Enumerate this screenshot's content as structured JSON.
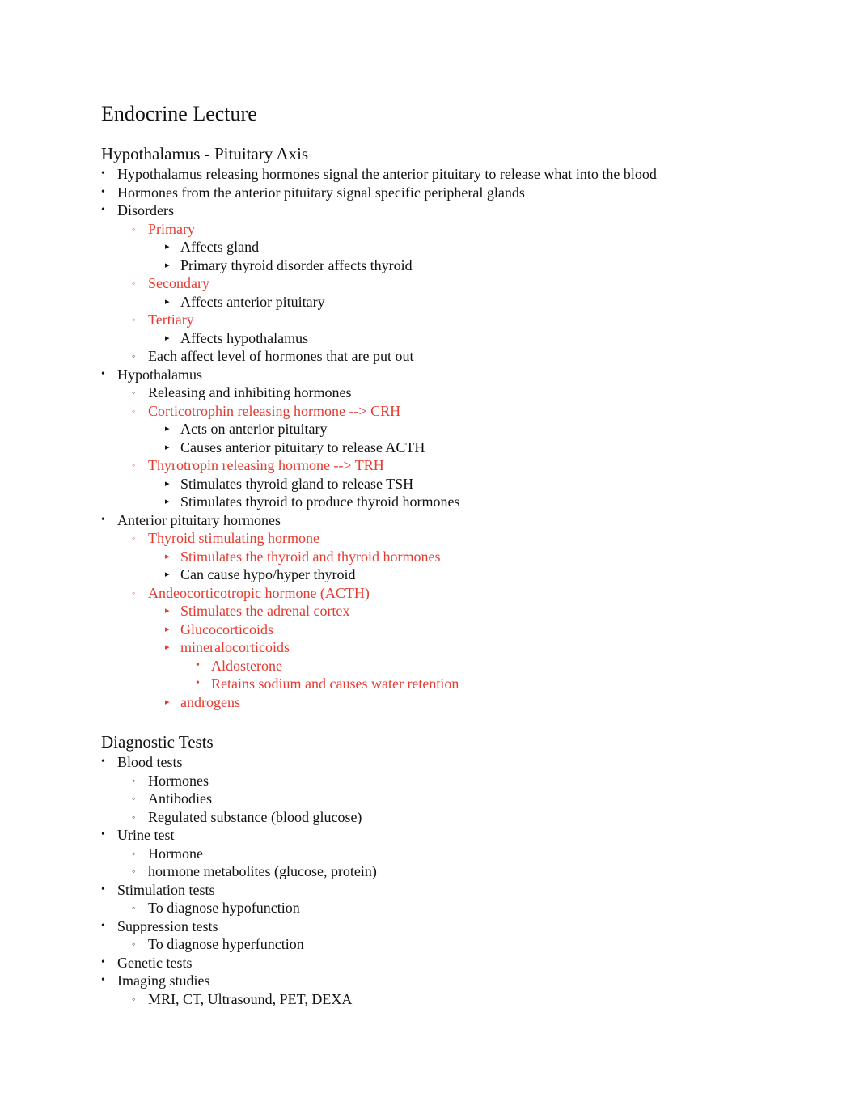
{
  "document": {
    "title": "Endocrine Lecture",
    "colors": {
      "text": "#111111",
      "highlight": "#e8392f"
    },
    "bullet_glyphs": {
      "level1": "•",
      "level2": "◦",
      "level3": "▸",
      "level4": "•"
    },
    "sections": [
      {
        "heading": "Hypothalamus - Pituitary Axis",
        "items": [
          {
            "level": 1,
            "text": "Hypothalamus releasing hormones signal the anterior pituitary to release what into the blood",
            "red": false
          },
          {
            "level": 1,
            "text": "Hormones from the anterior pituitary signal specific peripheral glands",
            "red": false
          },
          {
            "level": 1,
            "text": "Disorders",
            "red": false
          },
          {
            "level": 2,
            "text": "Primary",
            "red": true
          },
          {
            "level": 3,
            "text": "Affects gland",
            "red": false
          },
          {
            "level": 3,
            "text": "Primary thyroid disorder affects thyroid",
            "red": false
          },
          {
            "level": 2,
            "text": "Secondary",
            "red": true
          },
          {
            "level": 3,
            "text": "Affects anterior pituitary",
            "red": false
          },
          {
            "level": 2,
            "text": "Tertiary",
            "red": true
          },
          {
            "level": 3,
            "text": "Affects hypothalamus",
            "red": false
          },
          {
            "level": 2,
            "text": "Each affect level of hormones that are put out",
            "red": false
          },
          {
            "level": 1,
            "text": "Hypothalamus",
            "red": false
          },
          {
            "level": 2,
            "text": "Releasing and inhibiting hormones",
            "red": false
          },
          {
            "level": 2,
            "text": "Corticotrophin releasing hormone --> CRH",
            "red": true
          },
          {
            "level": 3,
            "text": "Acts on anterior pituitary",
            "red": false
          },
          {
            "level": 3,
            "text": "Causes anterior pituitary to release ACTH",
            "red": false
          },
          {
            "level": 2,
            "text": "Thyrotropin releasing hormone --> TRH",
            "red": true
          },
          {
            "level": 3,
            "text": "Stimulates thyroid gland to release TSH",
            "red": false
          },
          {
            "level": 3,
            "text": "Stimulates thyroid to produce thyroid hormones",
            "red": false
          },
          {
            "level": 1,
            "text": "Anterior pituitary hormones",
            "red": false
          },
          {
            "level": 2,
            "text": "Thyroid stimulating hormone",
            "red": true
          },
          {
            "level": 3,
            "text": "Stimulates the thyroid and thyroid hormones",
            "red": true
          },
          {
            "level": 3,
            "text": "Can cause hypo/hyper thyroid",
            "red": false
          },
          {
            "level": 2,
            "text": "Andeocorticotropic hormone (ACTH)",
            "red": true
          },
          {
            "level": 3,
            "text": "Stimulates the adrenal cortex",
            "red": true
          },
          {
            "level": 3,
            "text": "Glucocorticoids",
            "red": true
          },
          {
            "level": 3,
            "text": "mineralocorticoids",
            "red": true
          },
          {
            "level": 4,
            "text": "Aldosterone",
            "red": true
          },
          {
            "level": 4,
            "text": "Retains sodium and causes water retention",
            "red": true
          },
          {
            "level": 3,
            "text": "androgens",
            "red": true
          }
        ]
      },
      {
        "heading": "Diagnostic Tests",
        "items": [
          {
            "level": 1,
            "text": "Blood tests",
            "red": false
          },
          {
            "level": 2,
            "text": "Hormones",
            "red": false
          },
          {
            "level": 2,
            "text": "Antibodies",
            "red": false
          },
          {
            "level": 2,
            "text": "Regulated substance (blood glucose)",
            "red": false
          },
          {
            "level": 1,
            "text": "Urine test",
            "red": false
          },
          {
            "level": 2,
            "text": "Hormone",
            "red": false
          },
          {
            "level": 2,
            "text": "hormone metabolites (glucose, protein)",
            "red": false
          },
          {
            "level": 1,
            "text": "Stimulation tests",
            "red": false
          },
          {
            "level": 2,
            "text": "To diagnose hypofunction",
            "red": false
          },
          {
            "level": 1,
            "text": "Suppression tests",
            "red": false
          },
          {
            "level": 2,
            "text": "To diagnose hyperfunction",
            "red": false
          },
          {
            "level": 1,
            "text": "Genetic tests",
            "red": false
          },
          {
            "level": 1,
            "text": "Imaging studies",
            "red": false
          },
          {
            "level": 2,
            "text": "MRI, CT, Ultrasound, PET, DEXA",
            "red": false
          }
        ]
      }
    ]
  }
}
